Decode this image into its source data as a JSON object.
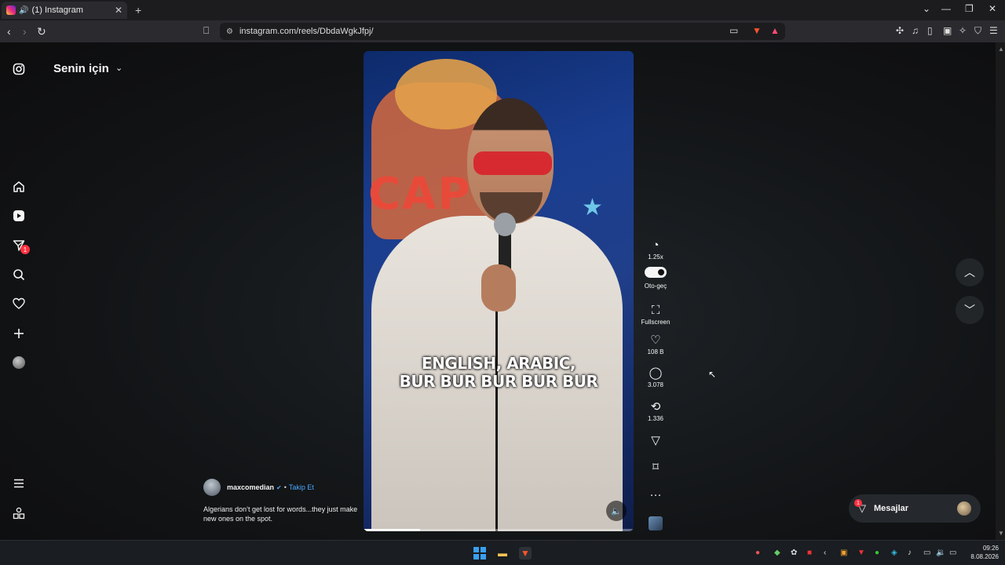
{
  "browser": {
    "tab_title": "(1) Instagram",
    "url": "instagram.com/reels/DbdaWgkJfpj/"
  },
  "feed": {
    "title": "Senin için"
  },
  "sidebar": {
    "notification_count": "1"
  },
  "video": {
    "caption_line1": "ENGLISH, ARABIC,",
    "caption_line2": "BUR BUR BUR BUR BUR",
    "background_sign": "CAP C",
    "progress_fraction": 0.21
  },
  "actions": {
    "speed": "1.25x",
    "autoplay": "Oto-geç",
    "fullscreen": "Fullscreen",
    "likes": "108 B",
    "comments": "3.078",
    "reposts": "1.336"
  },
  "post": {
    "username": "maxcomedian",
    "follow": "Takip Et",
    "description": "Algerians don’t get lost for words...they just make new ones on the spot."
  },
  "messages": {
    "label": "Mesajlar",
    "badge": "1"
  },
  "taskbar": {
    "time": "09:26",
    "date": "8.08.2026"
  }
}
